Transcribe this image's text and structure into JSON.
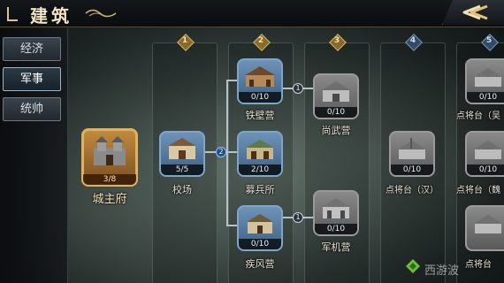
{
  "header": {
    "title": "建筑"
  },
  "sidebar": {
    "tabs": [
      {
        "label": "经济",
        "active": false
      },
      {
        "label": "军事",
        "active": true
      },
      {
        "label": "统帅",
        "active": false
      }
    ]
  },
  "columns": [
    {
      "number": "1",
      "locked": false
    },
    {
      "number": "2",
      "locked": false
    },
    {
      "number": "3",
      "locked": false
    },
    {
      "number": "4",
      "locked": true
    },
    {
      "number": "5",
      "locked": true
    }
  ],
  "buildings": {
    "castle": {
      "name": "城主府",
      "count": "3/8"
    },
    "camp": {
      "name": "校场",
      "count": "5/5"
    },
    "iron_camp": {
      "name": "铁壁营",
      "count": "0/10"
    },
    "recruit": {
      "name": "募兵所",
      "count": "2/10"
    },
    "wind_camp": {
      "name": "疾风营",
      "count": "0/10"
    },
    "shangwu": {
      "name": "尚武营",
      "count": "0/10"
    },
    "junji": {
      "name": "军机营",
      "count": "0/10"
    },
    "dianjiang_han": {
      "name": "点将台（汉）",
      "count": "0/10"
    },
    "dianjiang_wu": {
      "name": "点将台（吴",
      "count": "0/10"
    },
    "dianjiang_wei": {
      "name": "点将台（魏",
      "count": "0/10"
    },
    "dianjiang_partial": {
      "name": "点将台",
      "count": ""
    }
  },
  "connectors": {
    "camp_to_col2": "2",
    "iron_to_shangwu": "1",
    "wind_to_junji": "1"
  },
  "watermark": {
    "text": "西游波"
  },
  "colors": {
    "unlocked_frame": "#7fa6c8",
    "locked_frame": "#9a9a9a",
    "castle_frame": "#e1b25c",
    "badge_gold": "#8a6a2a",
    "badge_blue": "#324a66"
  }
}
